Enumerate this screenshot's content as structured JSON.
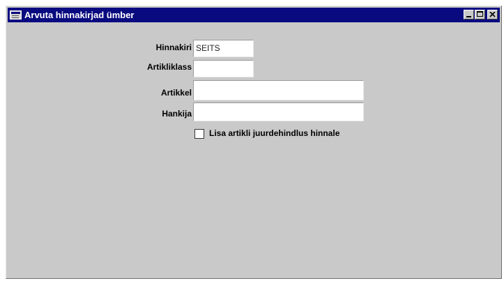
{
  "window": {
    "title": "Arvuta hinnakirjad ümber",
    "controls": {
      "minimize": "minimize",
      "maximize": "maximize",
      "close": "close"
    }
  },
  "form": {
    "fields": [
      {
        "label": "Hinnakiri",
        "value": "SEITS"
      },
      {
        "label": "Artikliklass",
        "value": ""
      },
      {
        "label": "Artikkel",
        "value": ""
      },
      {
        "label": "Hankija",
        "value": ""
      }
    ],
    "checkbox": {
      "label": "Lisa artikli juurdehindlus hinnale",
      "checked": false
    }
  },
  "colors": {
    "titlebar": "#0a0a80",
    "window_bg": "#c9c9c9"
  }
}
